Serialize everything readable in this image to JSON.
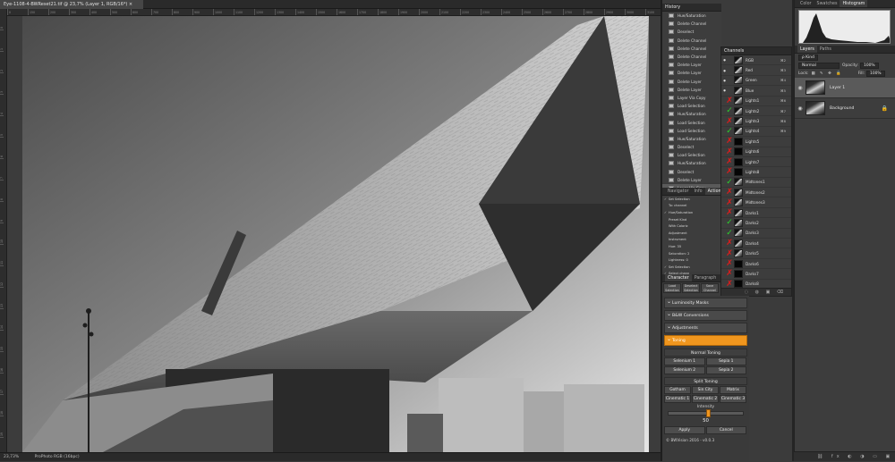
{
  "document": {
    "tab_title": "Eye-1108-4-BWReset21.tif @ 23,7% (Layer 1, RGB/16*) ×",
    "zoom": "23,73%",
    "color_profile": "ProPhoto RGB (16bpc)"
  },
  "rulers": {
    "top_ticks": [
      "0",
      "150",
      "200",
      "300",
      "400",
      "500",
      "600",
      "700",
      "800",
      "900",
      "1000",
      "1100",
      "1200",
      "1300",
      "1400",
      "1500",
      "1600",
      "1700",
      "1800",
      "1900",
      "2000",
      "2100",
      "2200",
      "2300",
      "2400",
      "2500",
      "2600",
      "2700",
      "2800",
      "2900",
      "3000",
      "3100"
    ],
    "left_ticks": [
      "0",
      "1",
      "2",
      "3",
      "4",
      "5",
      "6",
      "7",
      "8",
      "9",
      "10",
      "11",
      "12",
      "13",
      "14",
      "15",
      "16",
      "17",
      "18",
      "19",
      "20"
    ]
  },
  "history": {
    "title": "History",
    "items": [
      "Hue/Saturation",
      "Delete Channel",
      "Deselect",
      "Delete Channel",
      "Delete Channel",
      "Delete Channel",
      "Delete Layer",
      "Delete Layer",
      "Delete Layer",
      "Delete Layer",
      "Layer Via Copy",
      "Load Selection",
      "Hue/Saturation",
      "Load Selection",
      "Load Selection",
      "Hue/Saturation",
      "Deselect",
      "Load Selection",
      "Hue/Saturation",
      "Deselect",
      "Delete Layer",
      "Layer Via Copy"
    ]
  },
  "navigator": {
    "tabs": [
      "Navigator",
      "Info",
      "Actions"
    ],
    "actions": [
      {
        "check": "✓",
        "label": "Set Selection"
      },
      {
        "check": "",
        "label": "To: channel"
      },
      {
        "check": "✓",
        "label": "Hue/Saturation"
      },
      {
        "check": "",
        "label": "Preset Kind"
      },
      {
        "check": "",
        "label": "With Coloriz"
      },
      {
        "check": "",
        "label": "Adjustment"
      },
      {
        "check": "",
        "label": "Instrument"
      },
      {
        "check": "",
        "label": "Hue: 35"
      },
      {
        "check": "",
        "label": "Saturation: 2"
      },
      {
        "check": "",
        "label": "Lightness: 0"
      },
      {
        "check": "✓",
        "label": "Set Selection"
      },
      {
        "check": "✓",
        "label": "Select chann"
      }
    ]
  },
  "character": {
    "tabs": [
      "Character",
      "Paragraph",
      "Adobe"
    ],
    "buttons": [
      "Load Selection",
      "Deselect Selection",
      "Save Channel"
    ]
  },
  "channels": {
    "title": "Channels",
    "rows": [
      {
        "name": "RGB",
        "shortcut": "⌘2",
        "mark": "",
        "thumb": "img"
      },
      {
        "name": "Red",
        "shortcut": "⌘3",
        "mark": "",
        "thumb": "img"
      },
      {
        "name": "Green",
        "shortcut": "⌘4",
        "mark": "",
        "thumb": "img"
      },
      {
        "name": "Blue",
        "shortcut": "⌘5",
        "mark": "",
        "thumb": "img"
      },
      {
        "name": "Lights1",
        "shortcut": "⌘6",
        "mark": "red",
        "thumb": "img"
      },
      {
        "name": "Lights2",
        "shortcut": "⌘7",
        "mark": "green",
        "thumb": "img"
      },
      {
        "name": "Lights3",
        "shortcut": "⌘8",
        "mark": "red",
        "thumb": "img"
      },
      {
        "name": "Lights4",
        "shortcut": "⌘9",
        "mark": "green",
        "thumb": "img"
      },
      {
        "name": "Lights5",
        "shortcut": "",
        "mark": "red",
        "thumb": "dark"
      },
      {
        "name": "Lights6",
        "shortcut": "",
        "mark": "red",
        "thumb": "dark"
      },
      {
        "name": "Lights7",
        "shortcut": "",
        "mark": "red",
        "thumb": "dark"
      },
      {
        "name": "Lights8",
        "shortcut": "",
        "mark": "red",
        "thumb": "dark"
      },
      {
        "name": "Midtones1",
        "shortcut": "",
        "mark": "green",
        "thumb": "img"
      },
      {
        "name": "Midtones2",
        "shortcut": "",
        "mark": "red",
        "thumb": "img"
      },
      {
        "name": "Midtones3",
        "shortcut": "",
        "mark": "red",
        "thumb": "img"
      },
      {
        "name": "Darks1",
        "shortcut": "",
        "mark": "red",
        "thumb": "img"
      },
      {
        "name": "Darks2",
        "shortcut": "",
        "mark": "green",
        "thumb": "img"
      },
      {
        "name": "Darks3",
        "shortcut": "",
        "mark": "green",
        "thumb": "img"
      },
      {
        "name": "Darks4",
        "shortcut": "",
        "mark": "red",
        "thumb": "img"
      },
      {
        "name": "Darks5",
        "shortcut": "",
        "mark": "red",
        "thumb": "img"
      },
      {
        "name": "Darks6",
        "shortcut": "",
        "mark": "red",
        "thumb": "dark"
      },
      {
        "name": "Darks7",
        "shortcut": "",
        "mark": "red",
        "thumb": "dark"
      },
      {
        "name": "Darks8",
        "shortcut": "",
        "mark": "red",
        "thumb": "dark"
      }
    ],
    "footer_icons": "◌ ◍ ▣ ⌫"
  },
  "plugin": {
    "sections": [
      "Luminosity Masks",
      "B&W Conversions",
      "Adjustments"
    ],
    "toning": "Toning",
    "normal_toning": "Normal Toning",
    "normal_buttons": [
      [
        "Selenium 1",
        "Sepia 1"
      ],
      [
        "Selenium 2",
        "Sepia 2"
      ]
    ],
    "split_toning": "Split Toning",
    "split_buttons": [
      [
        "Gotham",
        "Sin City",
        "Matrix"
      ],
      [
        "Cinematic 1",
        "Cinematic 2",
        "Cinematic 3"
      ]
    ],
    "intensity_label": "Intensity",
    "intensity_value": "50",
    "intensity_fraction": 0.5,
    "apply": "Apply",
    "cancel": "Cancel",
    "footer": "© BWVision 2016 - v0.0.3",
    "accent_color": "#f0961e"
  },
  "histogram_panel": {
    "tabs": [
      "Color",
      "Swatches",
      "Histogram"
    ]
  },
  "layers": {
    "tabs": [
      "Layers",
      "Paths"
    ],
    "filter": "ρ Kind",
    "blend_mode": "Normal",
    "opacity_label": "Opacity:",
    "opacity": "100%",
    "lock_label": "Lock:",
    "fill_label": "Fill:",
    "fill": "100%",
    "items": [
      {
        "name": "Layer 1",
        "selected": true,
        "locked": false
      },
      {
        "name": "Background",
        "selected": false,
        "locked": true
      }
    ],
    "footer_icons": "⛓ fx ◐ ◑ ▭ ▣ 🗑"
  }
}
